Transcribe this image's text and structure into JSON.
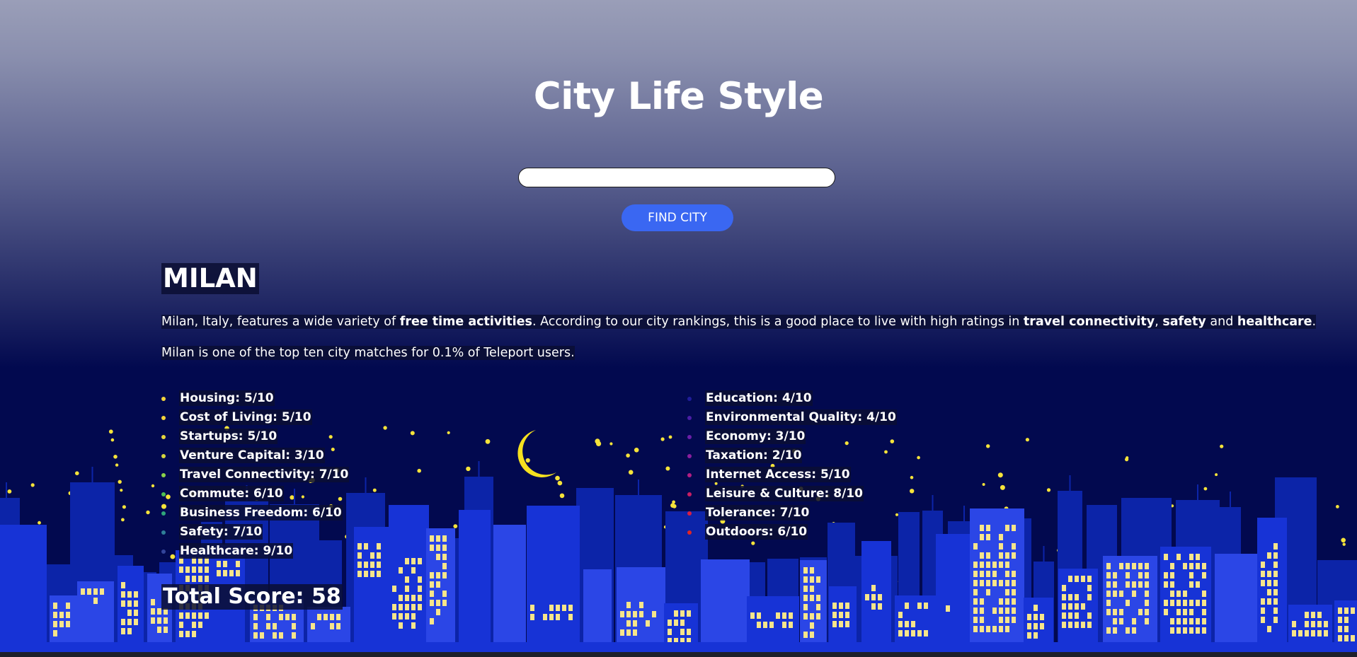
{
  "header": {
    "title": "City Life Style"
  },
  "search": {
    "value": "",
    "button_label": "FIND CITY"
  },
  "city": {
    "name": "MILAN",
    "summary": {
      "p1": "Milan, Italy, features a wide variety of ",
      "b1": "free time activities",
      "p2": ". According to our city rankings, this is a good place to live with high ratings in ",
      "b2": "travel connectivity",
      "p3": ", ",
      "b3": "safety",
      "p4": " and ",
      "b4": "healthcare",
      "p5": "."
    },
    "teleport_note": "Milan is one of the top ten city matches for 0.1% of Teleport users.",
    "scores_left": [
      {
        "label": "Housing: 5/10",
        "color": "#f3d43b"
      },
      {
        "label": "Cost of Living: 5/10",
        "color": "#f3d43b"
      },
      {
        "label": "Startups: 5/10",
        "color": "#e6d63c"
      },
      {
        "label": "Venture Capital: 3/10",
        "color": "#d6d63e"
      },
      {
        "label": "Travel Connectivity: 7/10",
        "color": "#8bd24a"
      },
      {
        "label": "Commute: 6/10",
        "color": "#4cbf52"
      },
      {
        "label": "Business Freedom: 6/10",
        "color": "#2fa67a"
      },
      {
        "label": "Safety: 7/10",
        "color": "#2f7e98"
      },
      {
        "label": "Healthcare: 9/10",
        "color": "#33449a"
      }
    ],
    "scores_right": [
      {
        "label": "Education: 4/10",
        "color": "#1f1c9a"
      },
      {
        "label": "Environmental Quality: 4/10",
        "color": "#4a1ea6"
      },
      {
        "label": "Economy: 3/10",
        "color": "#6a1ea8"
      },
      {
        "label": "Taxation: 2/10",
        "color": "#8a1e9e"
      },
      {
        "label": "Internet Access: 5/10",
        "color": "#b31e84"
      },
      {
        "label": "Leisure & Culture: 8/10",
        "color": "#c81e64"
      },
      {
        "label": "Tolerance: 7/10",
        "color": "#d81e44"
      },
      {
        "label": "Outdoors: 6/10",
        "color": "#e02525"
      }
    ],
    "total_score": "Total Score: 58"
  },
  "colors": {
    "night_sky": "#02094f",
    "button": "#3a67f2",
    "building_light": "#2b46e6",
    "building_mid": "#1733d6",
    "building_dark": "#0c24a8",
    "window": "#f7e58a",
    "star": "#f6e33a",
    "moon": "#f6e11f"
  },
  "icons": {
    "moon": "crescent-moon-icon"
  }
}
